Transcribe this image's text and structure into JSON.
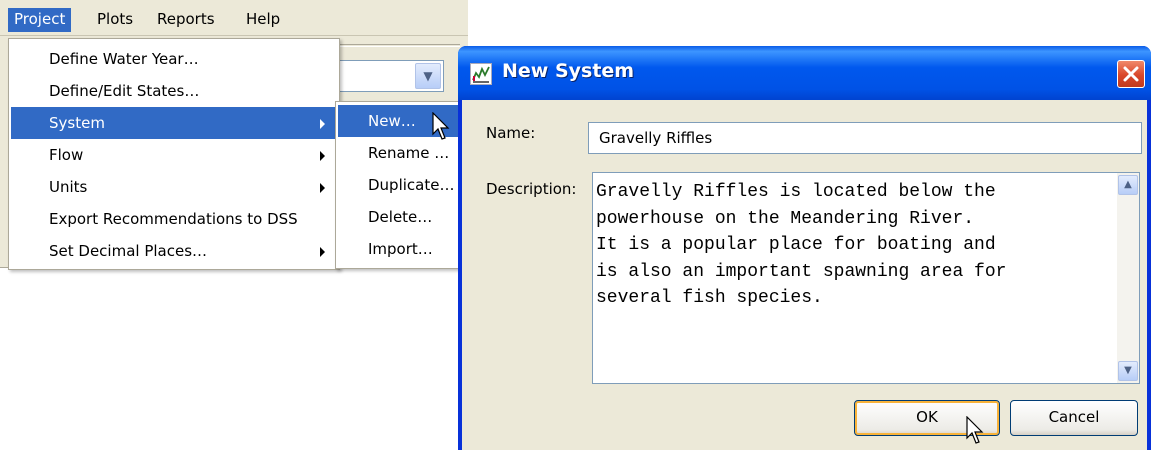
{
  "menubar": {
    "items": [
      "Project",
      "Plots",
      "Reports",
      "Help"
    ]
  },
  "project_menu": {
    "items": [
      {
        "label": "Define Water Year…"
      },
      {
        "label": "Define/Edit States…"
      },
      {
        "label": "System"
      },
      {
        "label": "Flow"
      },
      {
        "label": "Units"
      },
      {
        "label": "Export Recommendations to DSS"
      },
      {
        "label": "Set Decimal Places…"
      }
    ]
  },
  "system_submenu": {
    "items": [
      "New…",
      "Rename …",
      "Duplicate…",
      "Delete…",
      "Import…"
    ]
  },
  "dialog": {
    "title": "New System",
    "name_label": "Name:",
    "name_value": "Gravelly Riffles",
    "description_label": "Description:",
    "description_value": "Gravelly Riffles is located below the\npowerhouse on the Meandering River.\nIt is a popular place for boating and\nis also an important spawning area for\nseveral fish species.",
    "ok_label": "OK",
    "cancel_label": "Cancel"
  },
  "colors": {
    "menu_highlight": "#316ac5",
    "titlebar_blue": "#0058ee",
    "close_red": "#d9472a",
    "dialog_face": "#ece9d8",
    "default_button_ring": "#f8b33a"
  },
  "icons": [
    "app-icon",
    "close-icon",
    "submenu-arrow-icon",
    "dropdown-arrow-icon",
    "scroll-up-icon",
    "scroll-down-icon",
    "mouse-cursor-icon"
  ]
}
